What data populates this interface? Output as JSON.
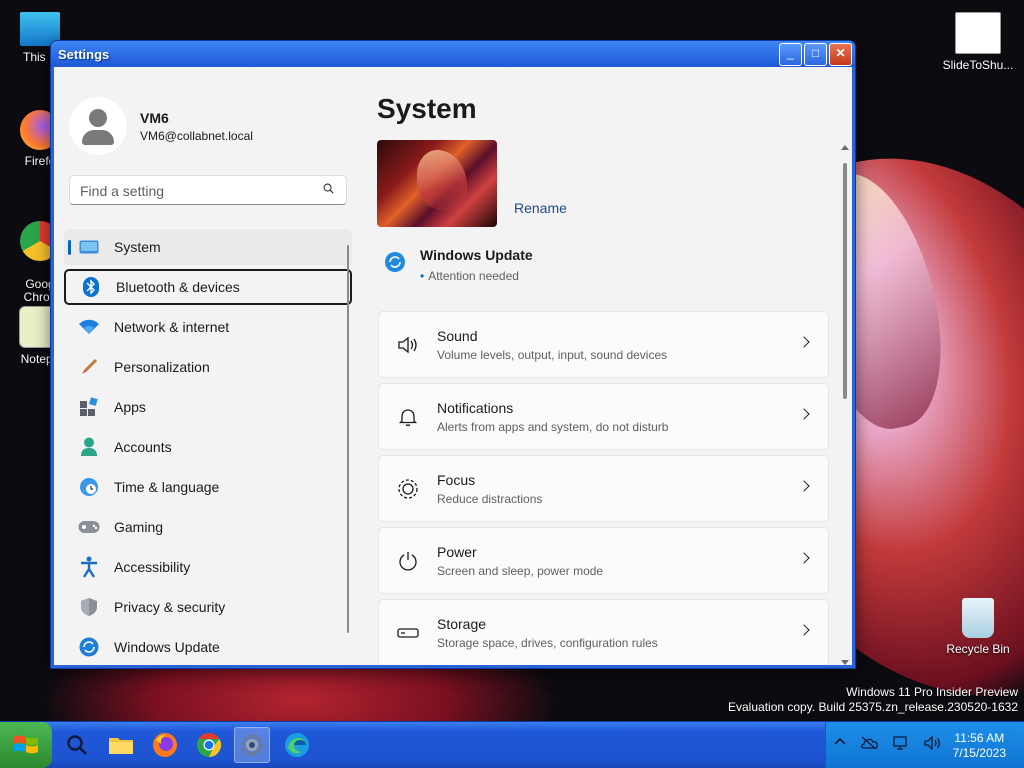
{
  "desktop": {
    "icons": [
      {
        "label": "This P"
      },
      {
        "label": "Firefo"
      },
      {
        "label": "Goog\nChron"
      },
      {
        "label": "Notepa"
      },
      {
        "label": "SlideToShu..."
      },
      {
        "label": "Recycle Bin"
      }
    ],
    "watermark": {
      "line1": "Windows 11 Pro Insider Preview",
      "line2": "Evaluation copy. Build 25375.zn_release.230520-1632"
    }
  },
  "window": {
    "title": "Settings",
    "buttons": {
      "minimize": "_",
      "maximize": "□",
      "close": "✕"
    }
  },
  "profile": {
    "name": "VM6",
    "email": "VM6@collabnet.local"
  },
  "search": {
    "placeholder": "Find a setting"
  },
  "nav": {
    "items": [
      {
        "label": "System",
        "icon": "monitor-icon"
      },
      {
        "label": "Bluetooth & devices",
        "icon": "bluetooth-icon"
      },
      {
        "label": "Network & internet",
        "icon": "wifi-icon"
      },
      {
        "label": "Personalization",
        "icon": "brush-icon"
      },
      {
        "label": "Apps",
        "icon": "apps-icon"
      },
      {
        "label": "Accounts",
        "icon": "person-icon"
      },
      {
        "label": "Time & language",
        "icon": "globe-clock-icon"
      },
      {
        "label": "Gaming",
        "icon": "gamepad-icon"
      },
      {
        "label": "Accessibility",
        "icon": "accessibility-icon"
      },
      {
        "label": "Privacy & security",
        "icon": "shield-icon"
      },
      {
        "label": "Windows Update",
        "icon": "update-icon"
      }
    ]
  },
  "main": {
    "title": "System",
    "rename": "Rename",
    "windows_update": {
      "title": "Windows Update",
      "status": "Attention needed"
    },
    "cards": [
      {
        "title": "Sound",
        "subtitle": "Volume levels, output, input, sound devices",
        "icon": "speaker-icon"
      },
      {
        "title": "Notifications",
        "subtitle": "Alerts from apps and system, do not disturb",
        "icon": "bell-icon"
      },
      {
        "title": "Focus",
        "subtitle": "Reduce distractions",
        "icon": "focus-icon"
      },
      {
        "title": "Power",
        "subtitle": "Screen and sleep, power mode",
        "icon": "power-icon"
      },
      {
        "title": "Storage",
        "subtitle": "Storage space, drives, configuration rules",
        "icon": "storage-icon"
      }
    ]
  },
  "taskbar": {
    "apps": [
      "search-icon",
      "file-explorer-icon",
      "firefox-icon",
      "chrome-icon",
      "settings-icon",
      "edge-icon"
    ],
    "clock": {
      "time": "11:56 AM",
      "date": "7/15/2023"
    }
  },
  "colors": {
    "accent": "#0067c0",
    "taskbar": "#1d53cf",
    "tray": "#0f74d2",
    "window_frame": "#2a63d6"
  }
}
